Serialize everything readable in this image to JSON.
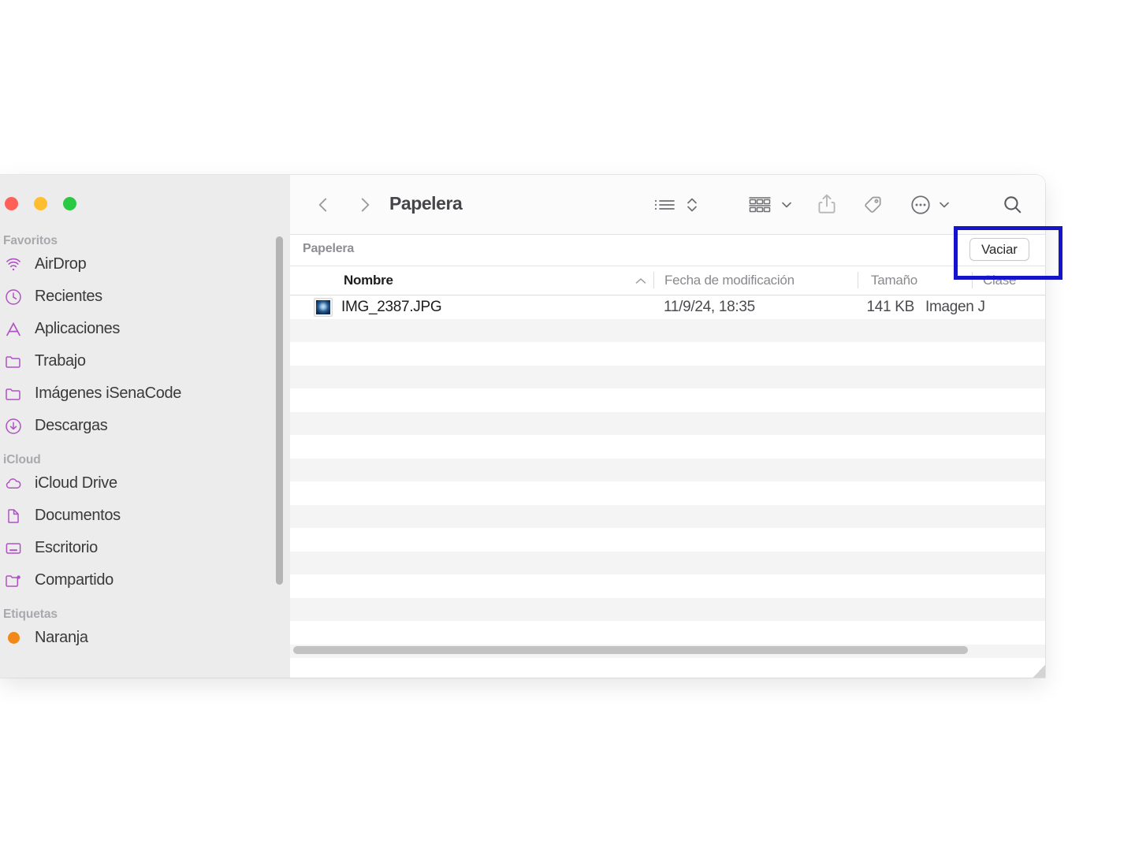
{
  "window": {
    "title": "Papelera",
    "traffic_lights": [
      {
        "name": "close",
        "color": "#ff6058"
      },
      {
        "name": "minimize",
        "color": "#ffbe2f"
      },
      {
        "name": "maximize",
        "color": "#29ca41"
      }
    ]
  },
  "sidebar": {
    "sections": [
      {
        "title": "Favoritos",
        "items": [
          {
            "label": "AirDrop",
            "icon": "airdrop-icon"
          },
          {
            "label": "Recientes",
            "icon": "clock-icon"
          },
          {
            "label": "Aplicaciones",
            "icon": "applications-icon"
          },
          {
            "label": "Trabajo",
            "icon": "folder-icon"
          },
          {
            "label": "Imágenes iSenaCode",
            "icon": "folder-icon"
          },
          {
            "label": "Descargas",
            "icon": "download-icon"
          }
        ]
      },
      {
        "title": "iCloud",
        "items": [
          {
            "label": "iCloud Drive",
            "icon": "cloud-icon"
          },
          {
            "label": "Documentos",
            "icon": "document-icon"
          },
          {
            "label": "Escritorio",
            "icon": "desktop-icon"
          },
          {
            "label": "Compartido",
            "icon": "shared-folder-icon"
          }
        ]
      },
      {
        "title": "Etiquetas",
        "items": [
          {
            "label": "Naranja",
            "icon": "tag-dot-icon",
            "color": "#f0881a"
          }
        ]
      }
    ],
    "accent_color": "#b051c4"
  },
  "toolbar": {
    "back": "back-chevron-icon",
    "forward": "forward-chevron-icon",
    "view_as_list": "list-view-icon",
    "sort_order": "sort-updown-icon",
    "group_by": "group-by-icon",
    "group_by_chevron": "chevron-down-icon",
    "share": "share-icon",
    "tag": "tag-icon",
    "more": "more-ellipsis-icon",
    "more_chevron": "chevron-down-icon",
    "search": "search-icon"
  },
  "path_bar": {
    "label": "Papelera",
    "empty_button_label": "Vaciar"
  },
  "columns": [
    {
      "key": "name",
      "label": "Nombre",
      "sorted": true,
      "sort_direction": "ascending"
    },
    {
      "key": "date",
      "label": "Fecha de modificación",
      "sorted": false
    },
    {
      "key": "size",
      "label": "Tamaño",
      "sorted": false
    },
    {
      "key": "kind",
      "label": "Clase",
      "sorted": false
    }
  ],
  "files": [
    {
      "name": "IMG_2387.JPG",
      "date": "11/9/24, 18:35",
      "size": "141 KB",
      "kind": "Imagen J",
      "icon": "jpeg-thumbnail-icon"
    }
  ],
  "annotation": {
    "target": "Vaciar",
    "color": "#1414c8"
  }
}
